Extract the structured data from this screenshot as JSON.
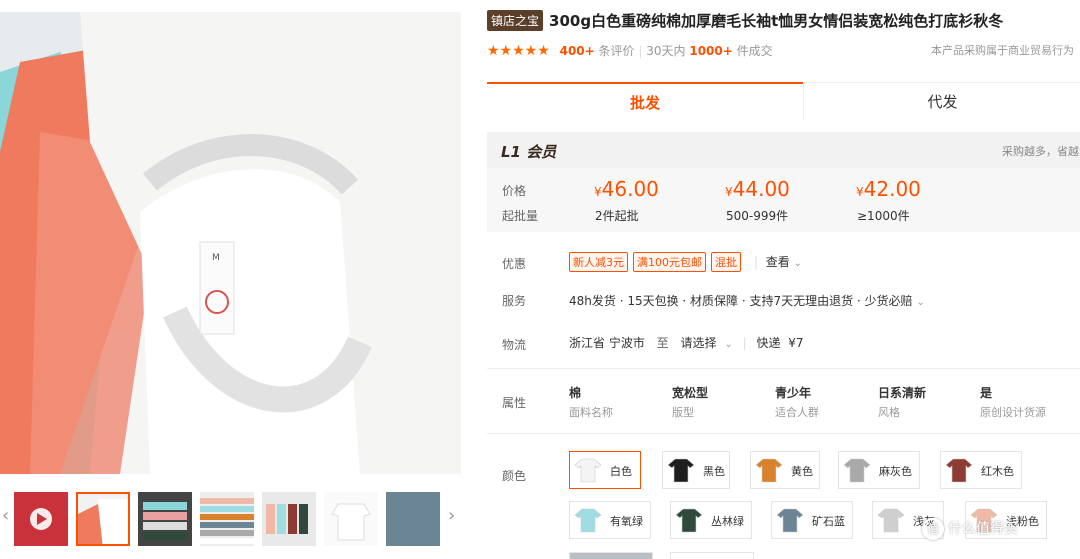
{
  "product": {
    "tag": "镇店之宝",
    "title": "300g白色重磅纯棉加厚磨毛长袖t恤男女情侣装宽松纯色打底衫秋冬"
  },
  "rating": {
    "stars": "★★★★★",
    "review_count": "400+",
    "review_label": "条评价",
    "sales_prefix": "30天内",
    "sales_count": "1000+",
    "sales_suffix": "件成交",
    "note": "本产品采购属于商业贸易行为"
  },
  "tabs": [
    {
      "label": "批发"
    },
    {
      "label": "代发"
    }
  ],
  "member": {
    "level": "L1 会员",
    "hint": "采购越多，省越"
  },
  "pricing": {
    "price_label": "价格",
    "moq_label": "起批量",
    "currency": "¥",
    "tiers": [
      {
        "price": "46.00",
        "qty": "2件起批"
      },
      {
        "price": "44.00",
        "qty": "500-999件"
      },
      {
        "price": "42.00",
        "qty": "≥1000件"
      }
    ]
  },
  "promo": {
    "label": "优惠",
    "badges": [
      "新人减3元",
      "满100元包邮",
      "混批"
    ],
    "more": "查看"
  },
  "service": {
    "label": "服务",
    "items": "48h发货 · 15天包换 · 材质保障 · 支持7天无理由退货 · 少货必赔"
  },
  "logistics": {
    "label": "物流",
    "from": "浙江省 宁波市",
    "to_word": "至",
    "select": "请选择",
    "express": "快递",
    "fee": "¥7"
  },
  "attributes": {
    "label": "属性",
    "items": [
      {
        "value": "棉",
        "key": "面料名称"
      },
      {
        "value": "宽松型",
        "key": "版型"
      },
      {
        "value": "青少年",
        "key": "适合人群"
      },
      {
        "value": "日系清新",
        "key": "风格"
      },
      {
        "value": "是",
        "key": "原创设计货源"
      }
    ]
  },
  "colors": {
    "label": "颜色",
    "items": [
      {
        "name": "白色",
        "hex": "#f4f4f4"
      },
      {
        "name": "黑色",
        "hex": "#1e1e1e"
      },
      {
        "name": "黄色",
        "hex": "#d9822b"
      },
      {
        "name": "麻灰色",
        "hex": "#a9a9a9"
      },
      {
        "name": "红木色",
        "hex": "#8e3b33"
      },
      {
        "name": "有氧绿",
        "hex": "#9fdde3"
      },
      {
        "name": "丛林绿",
        "hex": "#2f4a3c"
      },
      {
        "name": "矿石蓝",
        "hex": "#6c8595"
      },
      {
        "name": "浅灰",
        "hex": "#cfcfcf"
      },
      {
        "name": "浅粉色",
        "hex": "#f0b9a6"
      }
    ]
  },
  "watermark": "什么值得买",
  "colors_theme": {
    "accent": "#ff5000",
    "tag_bg": "#5c3f2a"
  }
}
